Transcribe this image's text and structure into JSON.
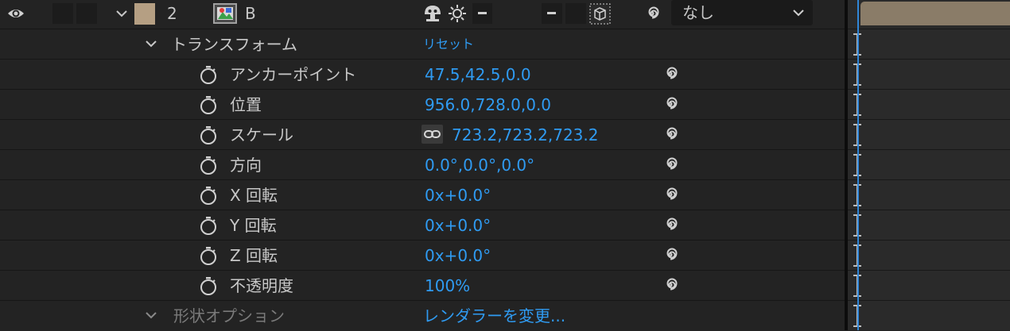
{
  "layer": {
    "number": "2",
    "name": "B",
    "parent_value": "なし",
    "label_color": "#b59f83"
  },
  "transform": {
    "group_label": "トランスフォーム",
    "reset_label": "リセット",
    "properties": [
      {
        "label": "アンカーポイント",
        "value": "47.5,42.5,0.0"
      },
      {
        "label": "位置",
        "value": "956.0,728.0,0.0"
      },
      {
        "label": "スケール",
        "value": "723.2,723.2,723.2"
      },
      {
        "label": "方向",
        "value": "0.0°,0.0°,0.0°"
      },
      {
        "label": "X 回転",
        "value": "0x+0.0°"
      },
      {
        "label": "Y 回転",
        "value": "0x+0.0°"
      },
      {
        "label": "Z 回転",
        "value": "0x+0.0°"
      },
      {
        "label": "不透明度",
        "value": "100%"
      }
    ]
  },
  "geometry_options": {
    "group_label": "形状オプション",
    "action_label": "レンダラーを変更..."
  },
  "colors": {
    "value_blue": "#2f9bf2",
    "current_time_indicator": "#2f86d8",
    "layer_bar": "#8a7c68"
  },
  "icons": [
    "eye-icon",
    "chevron-down-icon",
    "footage-composition-icon",
    "shy-icon",
    "sun-quality-icon",
    "pickwhip-spiral-icon",
    "stopwatch-icon",
    "constrain-proportions-link-icon",
    "collapse-transform-icon"
  ]
}
